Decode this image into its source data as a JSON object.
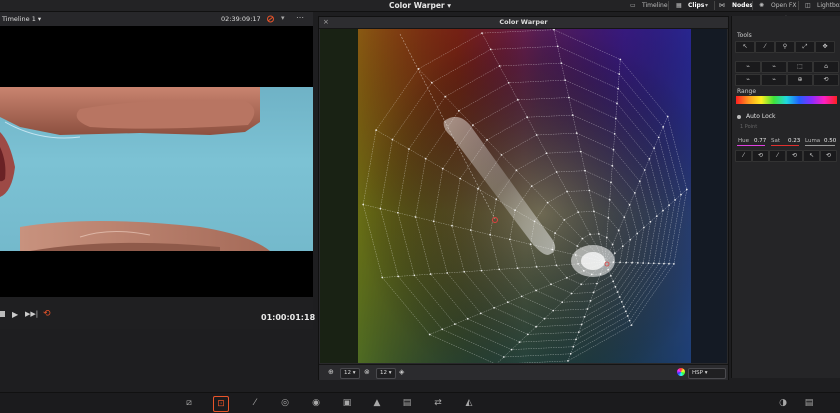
{
  "topbar": {
    "app_title": "Color Warper",
    "title_chevron": "▾",
    "timeline": "Timeline",
    "clips": "Clips",
    "nodes": "Nodes",
    "openfx": "Open FX",
    "lightbox": "Lightbox"
  },
  "viewer": {
    "timeline_name": "Timeline 1",
    "timeline_chevron": "▾",
    "timecode": "02:39:09:17",
    "transport_time": "01:00:01:18"
  },
  "warper": {
    "title": "Color Warper",
    "close": "×",
    "footer": {
      "grid_columns": "12",
      "grid_rows": "12",
      "color_space": "HSP"
    }
  },
  "tools": {
    "title": "Tools",
    "range_title": "Range",
    "auto_lock": "Auto Lock",
    "point_label": "1 Point",
    "hue_label": "Hue",
    "hue_value": "0.77",
    "sat_label": "Sat",
    "sat_value": "0.23",
    "luma_label": "Luma",
    "luma_value": "0.50"
  },
  "colors": {
    "accent": "#e8542a",
    "hue_line": "#e040e0",
    "sat_line": "#e03030",
    "luma_line": "#9a9a9a"
  },
  "icons": [
    "search-icon",
    "clips-icon",
    "nodes-icon",
    "openfx-icon",
    "lightbox-icon",
    "lock-icon",
    "grid-icon",
    "eyedropper-icon",
    "play-icon",
    "loop-icon",
    "pin-icon",
    "reset-icon"
  ]
}
